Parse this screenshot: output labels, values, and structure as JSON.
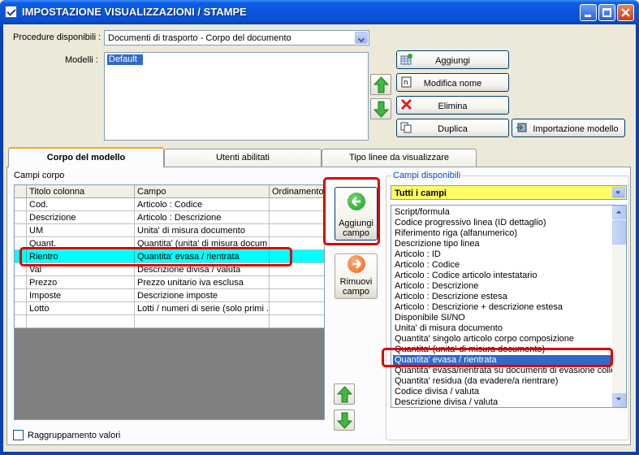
{
  "window": {
    "title": "IMPOSTAZIONE VISUALIZZAZIONI / STAMPE"
  },
  "procedure": {
    "label": "Procedure disponibili :",
    "value": "Documenti di trasporto - Corpo del documento"
  },
  "modelli": {
    "label": "Modelli :",
    "items": [
      "Default"
    ]
  },
  "model_buttons": {
    "aggiungi": "Aggiungi",
    "modifica": "Modifica nome",
    "elimina": "Elimina",
    "duplica": "Duplica",
    "importazione": "Importazione modello"
  },
  "tabs": [
    "Corpo del modello",
    "Utenti abilitati",
    "Tipo linee da visualizzare"
  ],
  "campi_corpo": {
    "label": "Campi corpo",
    "columns": [
      "Titolo colonna",
      "Campo",
      "Ordinamento"
    ],
    "rows": [
      {
        "titolo": "Cod.",
        "campo": "Articolo : Codice"
      },
      {
        "titolo": "Descrizione",
        "campo": "Articolo : Descrizione"
      },
      {
        "titolo": "UM",
        "campo": "Unita' di misura documento"
      },
      {
        "titolo": "Quant.",
        "campo": "Quantita' (unita' di misura docum"
      },
      {
        "titolo": "Rientro",
        "campo": "Quantita' evasa / rientrata"
      },
      {
        "titolo": "Val",
        "campo": "Descrizione divisa / valuta"
      },
      {
        "titolo": "Prezzo",
        "campo": "Prezzo unitario iva esclusa"
      },
      {
        "titolo": "Imposte",
        "campo": "Descrizione imposte"
      },
      {
        "titolo": "Lotto",
        "campo": "Lotti / numeri di serie (solo primi ..."
      },
      {
        "titolo": "",
        "campo": ""
      }
    ]
  },
  "aggiungi_campo": {
    "line1": "Aggiungi",
    "line2": "campo"
  },
  "rimuovi_campo": {
    "line1": "Rimuovi",
    "line2": "campo"
  },
  "campi_disponibili": {
    "label": "Campi disponibili",
    "filter": "Tutti i campi",
    "items": [
      "Script/formula",
      "Codice progressivo linea (ID dettaglio)",
      "Riferimento riga (alfanumerico)",
      "Descrizione tipo linea",
      "Articolo : ID",
      "Articolo : Codice",
      "Articolo : Codice articolo intestatario",
      "Articolo : Descrizione",
      "Articolo : Descrizione estesa",
      "Articolo : Descrizione + descrizione estesa",
      "Disponibile SI/NO",
      "Unita' di misura documento",
      "Quantita' singolo articolo corpo composizione",
      "Quantita' (unita' di misura documento)",
      "Quantita' evasa / rientrata",
      "Quantita' evasa/rientrata su documenti di evasione colleg",
      "Quantita' residua (da evadere/a rientrare)",
      "Codice divisa / valuta",
      "Descrizione divisa / valuta"
    ]
  },
  "raggruppamento": {
    "label": "Raggruppamento valori"
  }
}
